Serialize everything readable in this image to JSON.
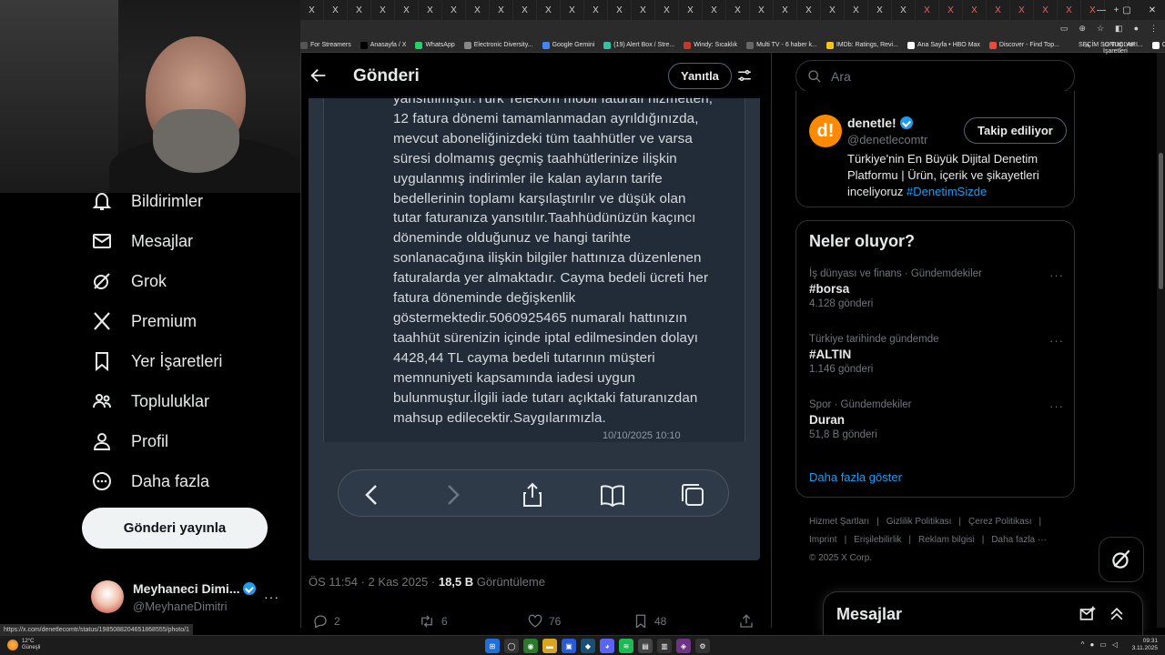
{
  "browser": {
    "tab_glyphs": [
      "X",
      "X",
      "X",
      "X",
      "X",
      "X",
      "X",
      "X",
      "X",
      "X",
      "X",
      "X",
      "X",
      "X",
      "X",
      "X",
      "X",
      "X",
      "X",
      "X",
      "X",
      "X",
      "X",
      "X",
      "X",
      "X",
      "X",
      "X",
      "X",
      "X",
      "X",
      "X",
      "X",
      "X"
    ],
    "new_tab_label": "+",
    "window_controls": [
      "—",
      "▢",
      "✕"
    ],
    "bookmarks": [
      {
        "label": "For Streamers",
        "color": "#555555"
      },
      {
        "label": "Anasayfa / X",
        "color": "#000000"
      },
      {
        "label": "WhatsApp",
        "color": "#25d366"
      },
      {
        "label": "Electronic Diversity...",
        "color": "#888888"
      },
      {
        "label": "Google Gemini",
        "color": "#4285f4"
      },
      {
        "label": "(19) Alert Box / Stre...",
        "color": "#31c3a2"
      },
      {
        "label": "Windy: Sıcaklık",
        "color": "#c0392b"
      },
      {
        "label": "Multi TV - 6 haber k...",
        "color": "#666666"
      },
      {
        "label": "IMDb: Ratings, Revi...",
        "color": "#f5c518"
      },
      {
        "label": "Ana Sayfa • HBO Max",
        "color": "#ffffff"
      },
      {
        "label": "Discover - Find Top...",
        "color": "#e74c3c"
      },
      {
        "label": "SEÇİM SONUÇLARI...",
        "color": "#2b2b2b"
      },
      {
        "label": "ChatGPT",
        "color": "#ffffff"
      }
    ],
    "bookmarks_more": "»",
    "all_bookmarks": "Tüm Yer İşaretleri",
    "status_url": "https://x.com/denetlecomtr/status/1985088204651868555/photo/1"
  },
  "nav": {
    "items": [
      {
        "label": "Bildirimler",
        "icon": "bell-icon"
      },
      {
        "label": "Mesajlar",
        "icon": "mail-icon"
      },
      {
        "label": "Grok",
        "icon": "grok-icon"
      },
      {
        "label": "Premium",
        "icon": "x-logo-icon"
      },
      {
        "label": "Yer İşaretleri",
        "icon": "bookmark-icon"
      },
      {
        "label": "Topluluklar",
        "icon": "communities-icon"
      },
      {
        "label": "Profil",
        "icon": "profile-icon"
      },
      {
        "label": "Daha fazla",
        "icon": "more-circle-icon"
      }
    ],
    "post_button": "Gönderi yayınla",
    "account": {
      "name": "Meyhaneci Dimi...",
      "handle": "@MeyhaneDimitri",
      "more": "···"
    }
  },
  "post": {
    "header_title": "Gönderi",
    "reply_button": "Yanıtla",
    "image_text": [
      "yansıtılmıştır.Türk Telekom mobil faturalı hizmetten,",
      "12 fatura dönemi tamamlanmadan ayrıldığınızda,",
      "mevcut aboneliğinizdeki tüm taahhütler ve varsa",
      "süresi dolmamış geçmiş taahhütlerinize ilişkin",
      "uygulanmış indirimler ile kalan ayların tarife",
      "bedellerinin toplamı karşılaştırılır ve düşük olan",
      "tutar faturanıza yansıtılır.Taahhüdünüzün kaçıncı",
      "döneminde olduğunuz ve hangi tarihte",
      "sonlanacağına ilişkin bilgiler hattınıza düzenlenen",
      "faturalarda yer almaktadır. Cayma bedeli ücreti her",
      "fatura döneminde değişkenlik",
      "göstermektedir.5060925465 numaralı hattınızın",
      "taahhüt sürenizin içinde iptal edilmesinden dolayı",
      "4428,44 TL cayma bedeli tutarının müşteri",
      "memnuniyeti kapsamında iadesi uygun",
      "bulunmuştur.İlgili iade tutarı açıktaki faturanızdan",
      "mahsup edilecektir.Saygılarımızla."
    ],
    "image_timestamp": "10/10/2025 10:10",
    "meta_time": "ÖS 11:54 · 2 Kas 2025 · ",
    "views_count": "18,5 B",
    "views_label": " Görüntüleme",
    "actions": {
      "replies": "2",
      "reposts": "6",
      "likes": "76",
      "bookmarks": "48"
    }
  },
  "sidebar": {
    "search_placeholder": "Ara",
    "ad": {
      "logo_text": "d!",
      "name": "denetle!",
      "handle": "@denetlecomtr",
      "follow_button": "Takip ediliyor",
      "bio": "Türkiye'nin En Büyük Dijital Denetim Platformu | Ürün, içerik ve şikayetleri inceliyoruz ",
      "bio_hashtag": "#DenetimSizde"
    },
    "trends_title": "Neler oluyor?",
    "trends": [
      {
        "category": "İş dünyası ve finans · Gündemdekiler",
        "name": "#borsa",
        "count": "4.128 gönderi"
      },
      {
        "category": "Türkiye tarihinde gündemde",
        "name": "#ALTIN",
        "count": "1.146 gönderi"
      },
      {
        "category": "Spor · Gündemdekiler",
        "name": "Duran",
        "count": "51,8 B gönderi"
      }
    ],
    "show_more": "Daha fazla göster",
    "footer": {
      "line1": [
        "Hizmet Şartları",
        "|",
        "Gizlilik Politikası",
        "|",
        "Çerez Politikası",
        "|"
      ],
      "line2": [
        "Imprint",
        "|",
        "Erişilebilirlik",
        "|",
        "Reklam bilgisi",
        "|",
        "Daha fazla ···"
      ],
      "copyright": "© 2025 X Corp."
    },
    "messages_drawer": "Mesajlar"
  },
  "taskbar": {
    "weather_temp": "12°C",
    "weather_desc": "Güneşli",
    "clock_time": "09:31",
    "clock_date": "3.11.2025"
  },
  "colors": {
    "accent": "#1d9bf0",
    "background": "#000000",
    "border": "#2f3336",
    "muted": "#71767b"
  }
}
